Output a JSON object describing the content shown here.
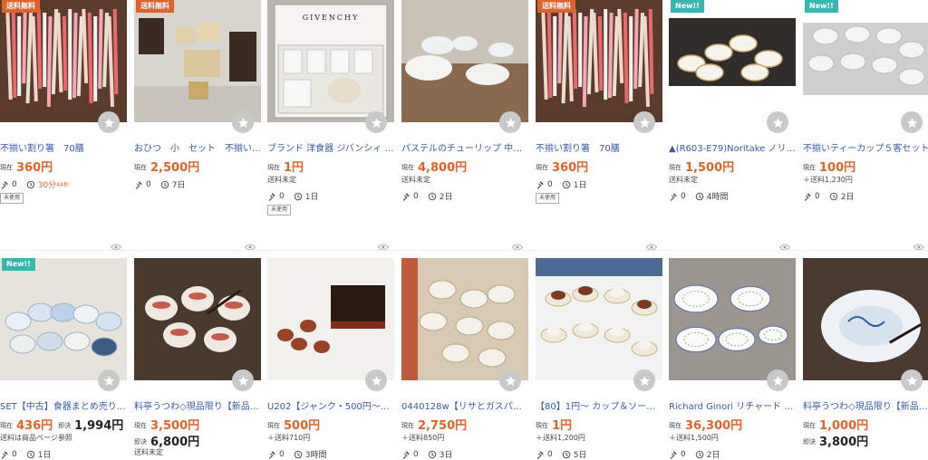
{
  "colors": {
    "accent": "#e4622a",
    "link": "#365aa8",
    "new_badge": "#39b6b0",
    "shipping_badge": "#e0622b"
  },
  "rows": [
    [
      {
        "badge": "送料無料",
        "badge_type": "ship",
        "title": "不揃い割り箸　70膳",
        "current_label": "現在",
        "current_price": "360円",
        "shipping": "",
        "bids": "0",
        "time": "30分",
        "time_sub": "44秒",
        "time_urgent": true,
        "tag": "未使用",
        "icon": "chopsticks-image"
      },
      {
        "badge": "送料無料",
        "badge_type": "ship",
        "title": "おひつ　小　セット　不揃い　…",
        "current_label": "現在",
        "current_price": "2,500円",
        "shipping": "",
        "bids": "0",
        "time": "7日",
        "time_sub": "",
        "time_urgent": false,
        "tag": "",
        "icon": "wooden-boxes-image"
      },
      {
        "badge": "",
        "badge_type": "",
        "title": "ブランド 洋食器 ジバンシィ ド…",
        "current_label": "現在",
        "current_price": "1円",
        "shipping": "送料未定",
        "bids": "0",
        "time": "1日",
        "time_sub": "",
        "time_urgent": false,
        "tag": "未使用",
        "icon": "givenchy-box-image",
        "brand_text": "GIVENCHY"
      },
      {
        "badge": "",
        "badge_type": "",
        "title": "パステルのチューリップ 中古枚…",
        "current_label": "現在",
        "current_price": "4,800円",
        "shipping": "送料未定",
        "bids": "0",
        "time": "2日",
        "time_sub": "",
        "time_urgent": false,
        "tag": "",
        "icon": "plates-image"
      },
      {
        "badge": "送料無料",
        "badge_type": "ship",
        "title": "不揃い割り箸　70膳",
        "current_label": "現在",
        "current_price": "360円",
        "shipping": "",
        "bids": "0",
        "time": "1日",
        "time_sub": "",
        "time_urgent": false,
        "tag": "未使用",
        "icon": "chopsticks-image"
      },
      {
        "badge": "New!!",
        "badge_type": "new",
        "title": "▲(R603-E79)Noritake ノリタ…",
        "current_label": "現在",
        "current_price": "1,500円",
        "shipping": "送料未定",
        "bids": "0",
        "time": "4時間",
        "time_sub": "",
        "time_urgent": false,
        "tag": "",
        "icon": "noritake-set-image"
      },
      {
        "badge": "New!!",
        "badge_type": "new",
        "title": "不揃いティーカップ５客セット",
        "current_label": "現在",
        "current_price": "100円",
        "shipping": "＋送料1,230円",
        "bids": "0",
        "time": "2日",
        "time_sub": "",
        "time_urgent": false,
        "tag": "",
        "icon": "teacups-image"
      }
    ],
    [
      {
        "badge": "New!!",
        "badge_type": "new",
        "title": "SET【中古】食器まとめ売り メ…",
        "current_label": "現在",
        "current_price": "436円",
        "buy_label": "即決",
        "buy_price": "1,994円",
        "shipping": "送料は商品ページ参照",
        "bids": "0",
        "time": "1日",
        "time_sub": "",
        "time_urgent": false,
        "tag": "",
        "icon": "bowls-set-image"
      },
      {
        "badge": "",
        "badge_type": "",
        "title": "料亭うつわ◇現品限り【新品・…",
        "current_label": "現在",
        "current_price": "3,500円",
        "buy_label": "即決",
        "buy_price": "6,800円",
        "shipping": "送料未定",
        "bids": "",
        "time": "",
        "time_sub": "",
        "time_urgent": false,
        "tag": "",
        "icon": "lidded-bowls-image"
      },
      {
        "badge": "",
        "badge_type": "",
        "title": "U202【ジャンク・500円〜】会…",
        "current_label": "現在",
        "current_price": "500円",
        "shipping": "＋送料710円",
        "bids": "0",
        "time": "3時間",
        "time_sub": "",
        "time_urgent": false,
        "tag": "",
        "icon": "lacquerware-image"
      },
      {
        "badge": "",
        "badge_type": "",
        "title": "0440128w【リサとガスパール …",
        "current_label": "現在",
        "current_price": "2,750円",
        "shipping": "＋送料850円",
        "bids": "0",
        "time": "3日",
        "time_sub": "",
        "time_urgent": false,
        "tag": "",
        "icon": "lisa-gaspard-image"
      },
      {
        "badge": "",
        "badge_type": "",
        "title": "【80】1円〜 カップ＆ソーサー …",
        "current_label": "現在",
        "current_price": "1円",
        "shipping": "＋送料1,200円",
        "bids": "0",
        "time": "5日",
        "time_sub": "",
        "time_urgent": false,
        "tag": "",
        "icon": "cup-saucer-image"
      },
      {
        "badge": "",
        "badge_type": "",
        "title": "Richard Ginori リチャード ジノ…",
        "current_label": "現在",
        "current_price": "36,300円",
        "shipping": "＋送料1,500円",
        "bids": "0",
        "time": "2日",
        "time_sub": "",
        "time_urgent": false,
        "tag": "",
        "icon": "ginori-plates-image"
      },
      {
        "badge": "",
        "badge_type": "",
        "title": "料亭うつわ◇現品限り【新品×…",
        "current_label": "現在",
        "current_price": "1,000円",
        "buy_label": "即決",
        "buy_price": "3,800円",
        "shipping": "",
        "bids": "",
        "time": "",
        "time_sub": "",
        "time_urgent": false,
        "tag": "",
        "icon": "blue-dish-image"
      }
    ]
  ]
}
